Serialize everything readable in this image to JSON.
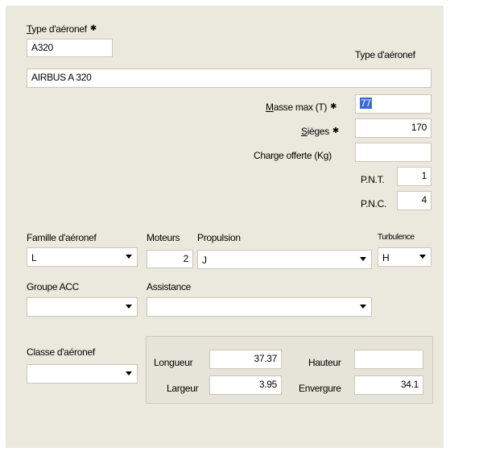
{
  "type_aeronef": {
    "label_prefix": "T",
    "label_rest": "ype d'aéronef",
    "star": "✱",
    "code": "A320",
    "desc_label": "Type d'aéronef",
    "desc_value": "AIRBUS A 320"
  },
  "masse": {
    "label_prefix": "M",
    "label_rest": "asse max (T)",
    "star": "✱",
    "value": "77"
  },
  "sieges": {
    "label_prefix": "S",
    "label_rest": "ièges",
    "star": "✱",
    "value": "170"
  },
  "charge": {
    "label": "Charge offerte (Kg)",
    "value": ""
  },
  "pnt": {
    "label": "P.N.T.",
    "value": "1"
  },
  "pnc": {
    "label": "P.N.C.",
    "value": "4"
  },
  "famille": {
    "label": "Famille d'aéronef",
    "value": "L"
  },
  "moteurs": {
    "label": "Moteurs",
    "value": "2"
  },
  "propulsion": {
    "label": "Propulsion",
    "value": "J"
  },
  "turbulence": {
    "label": "Turbulence",
    "value": "H"
  },
  "groupe_acc": {
    "label": "Groupe ACC",
    "value": ""
  },
  "assistance": {
    "label": "Assistance",
    "value": ""
  },
  "classe": {
    "label": "Classe d'aéronef",
    "value": ""
  },
  "dimensions": {
    "longueur": {
      "label": "Longueur",
      "value": "37.37"
    },
    "largeur": {
      "label": "Largeur",
      "value": "3.95"
    },
    "hauteur": {
      "label": "Hauteur",
      "value": ""
    },
    "envergure": {
      "label": "Envergure",
      "value": "34.1"
    }
  },
  "icons": {
    "dropdown": "chevron-down-icon"
  },
  "colors": {
    "background": "#ebe9dd",
    "selection": "#3a6ad1"
  }
}
